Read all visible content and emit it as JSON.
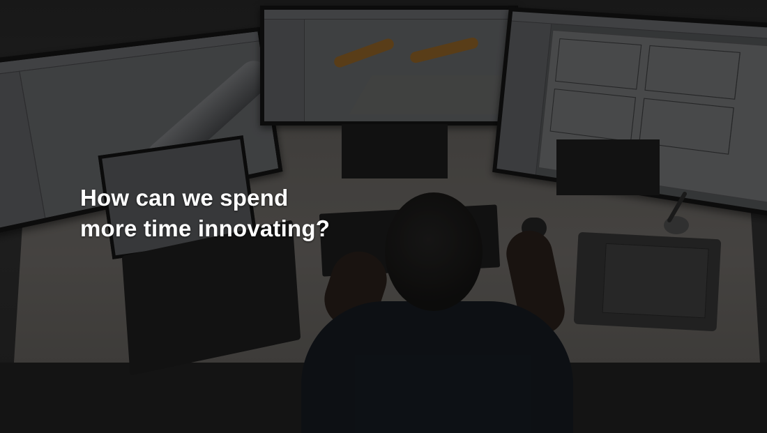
{
  "slide": {
    "headline_lines": [
      "How can we spend",
      "more time innovating?"
    ],
    "text_color": "#ffffff",
    "overlay_color": "#000000"
  },
  "scene": {
    "background_photo": "engineer-at-desk-with-cad-monitors",
    "objects": [
      "left-monitor",
      "center-monitor",
      "right-monitor",
      "laptop",
      "keyboard",
      "mouse",
      "drawing-tablet",
      "stylus-pen",
      "person"
    ]
  }
}
